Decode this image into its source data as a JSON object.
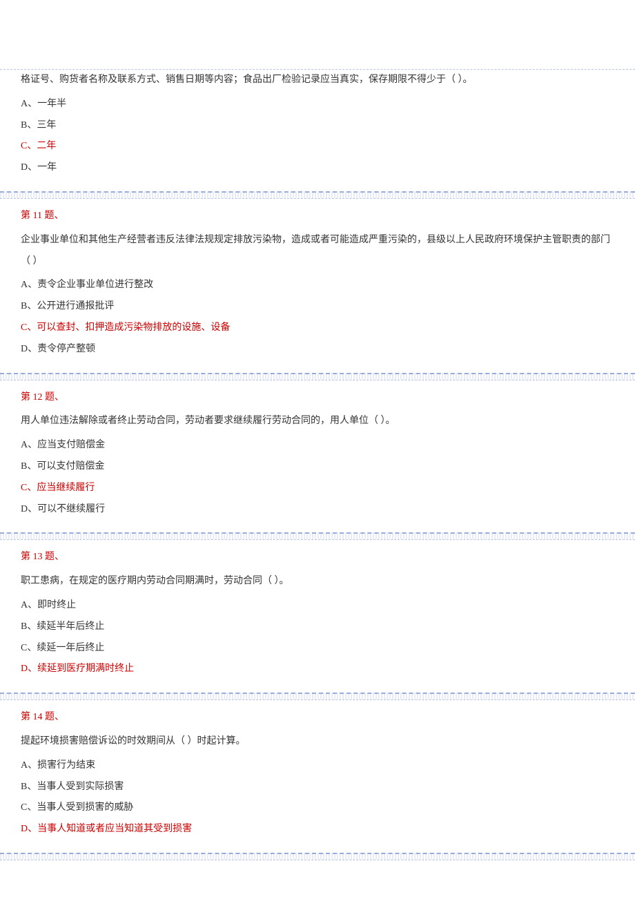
{
  "q10": {
    "continued_text": "格证号、购货者名称及联系方式、销售日期等内容；食品出厂检验记录应当真实，保存期限不得少于（  ）。",
    "options": {
      "a": "A、一年半",
      "b": "B、三年",
      "c": "C、二年",
      "d": "D、一年"
    }
  },
  "q11": {
    "title": "第 11 题、",
    "text": "企业事业单位和其他生产经营者违反法律法规规定排放污染物，造成或者可能造成严重污染的，县级以上人民政府环境保护主管职责的部门（  ）",
    "options": {
      "a": "A、责令企业事业单位进行整改",
      "b": "B、公开进行通报批评",
      "c": "C、可以查封、扣押造成污染物排放的设施、设备",
      "d": "D、责令停产整顿"
    }
  },
  "q12": {
    "title": "第 12 题、",
    "text": "用人单位违法解除或者终止劳动合同，劳动者要求继续履行劳动合同的，用人单位（  ）。",
    "options": {
      "a": "A、应当支付赔偿金",
      "b": "B、可以支付赔偿金",
      "c": "C、应当继续履行",
      "d": "D、可以不继续履行"
    }
  },
  "q13": {
    "title": "第 13 题、",
    "text": "职工患病，在规定的医疗期内劳动合同期满时，劳动合同（  ）。",
    "options": {
      "a": "A、即时终止",
      "b": "B、续延半年后终止",
      "c": "C、续延一年后终止",
      "d": "D、续延到医疗期满时终止"
    }
  },
  "q14": {
    "title": "第 14 题、",
    "text": "提起环境损害赔偿诉讼的时效期间从（  ）时起计算。",
    "options": {
      "a": "A、损害行为结束",
      "b": "B、当事人受到实际损害",
      "c": "C、当事人受到损害的威胁",
      "d": "D、当事人知道或者应当知道其受到损害"
    }
  }
}
